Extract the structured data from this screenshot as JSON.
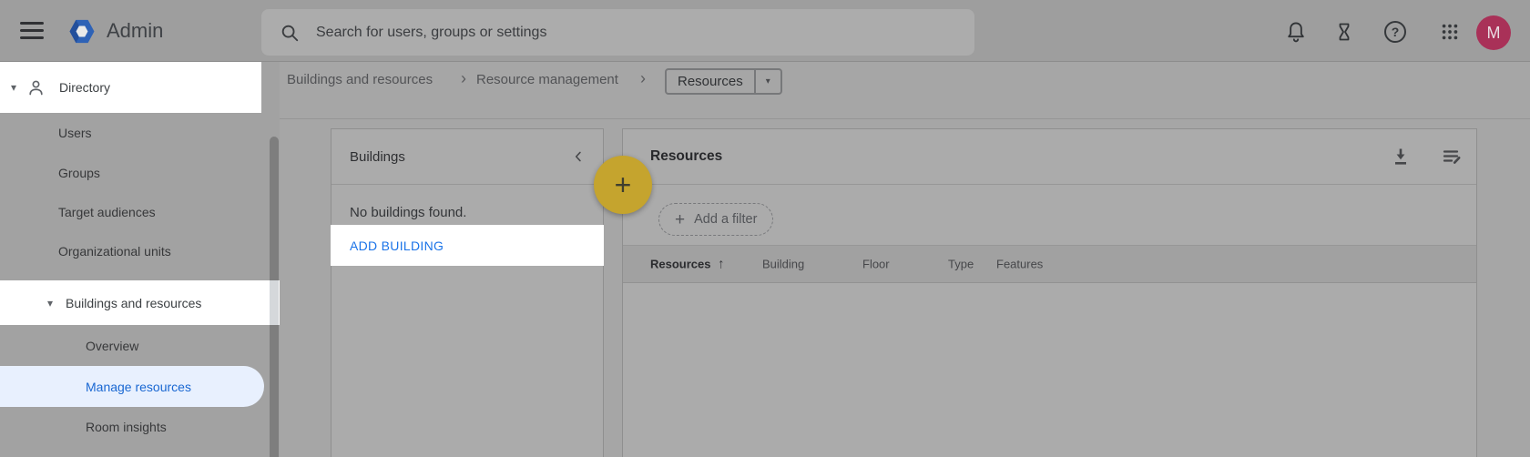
{
  "topbar": {
    "brand": "Admin",
    "search_placeholder": "Search for users, groups or settings",
    "avatar_initial": "M"
  },
  "breadcrumb": {
    "items": [
      "Buildings and resources",
      "Resource management"
    ],
    "current": "Resources"
  },
  "sidebar": {
    "directory": {
      "label": "Directory"
    },
    "directory_items": [
      {
        "label": "Users"
      },
      {
        "label": "Groups"
      },
      {
        "label": "Target audiences"
      },
      {
        "label": "Organizational units"
      }
    ],
    "buildings_section": {
      "label": "Buildings and resources"
    },
    "buildings_items": [
      {
        "label": "Overview"
      },
      {
        "label": "Manage resources",
        "active": true
      },
      {
        "label": "Room insights"
      }
    ]
  },
  "buildings_panel": {
    "title": "Buildings",
    "empty_text": "No buildings found.",
    "add_button_label": "ADD BUILDING"
  },
  "resources_panel": {
    "title": "Resources",
    "filter_label": "Add a filter",
    "columns": [
      "Resources",
      "Building",
      "Floor",
      "Type",
      "Features"
    ],
    "sort_column": "Resources",
    "sort_direction": "ascending"
  },
  "fab": {
    "label": "+"
  },
  "icons": {
    "caret_down": "▾",
    "dropdown_arrow": "▾",
    "breadcrumb_separator": "›",
    "plus": "+",
    "sort_up": "↑",
    "help": "?"
  },
  "colors": {
    "accent_blue": "#1a73e8",
    "active_item_bg": "#e8f0fe",
    "fab_yellow": "#c5a42e",
    "avatar_maroon": "#a93158"
  }
}
